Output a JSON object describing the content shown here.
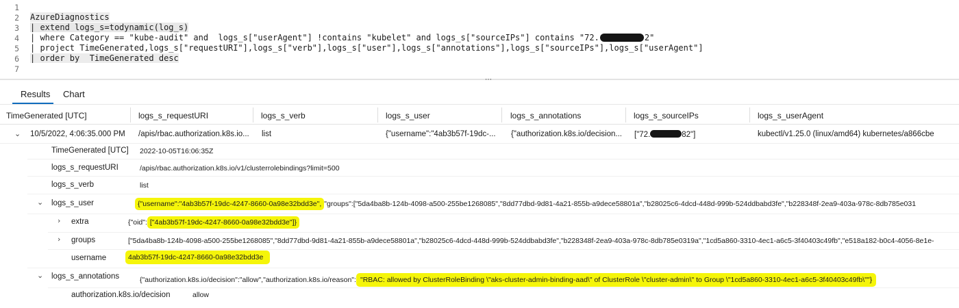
{
  "editor": {
    "line_numbers": [
      "1",
      "2",
      "3",
      "4",
      "5",
      "6",
      "7"
    ],
    "lines": {
      "l2": "AzureDiagnostics",
      "l3": "| extend logs_s=todynamic(log_s)",
      "l4a": "| where Category == \"kube-audit\" and  logs_s[\"userAgent\"] !contains \"kubelet\" and logs_s[\"sourceIPs\"] contains \"72.",
      "l4b": "2\"",
      "l5": "| project TimeGenerated,logs_s[\"requestURI\"],logs_s[\"verb\"],logs_s[\"user\"],logs_s[\"annotations\"],logs_s[\"sourceIPs\"],logs_s[\"userAgent\"]",
      "l6": "| order by  TimeGenerated desc"
    },
    "splitter_grip": "⋯"
  },
  "tabs": {
    "results": "Results",
    "chart": "Chart"
  },
  "columns": {
    "c1": "TimeGenerated [UTC]",
    "c2": "logs_s_requestURI",
    "c3": "logs_s_verb",
    "c4": "logs_s_user",
    "c5": "logs_s_annotations",
    "c6": "logs_s_sourceIPs",
    "c7": "logs_s_userAgent"
  },
  "row": {
    "time": "10/5/2022, 4:06:35.000 PM",
    "request_uri": "/apis/rbac.authorization.k8s.io...",
    "verb": "list",
    "user": "{\"username\":\"4ab3b57f-19dc-...",
    "annotations": "{\"authorization.k8s.io/decision...",
    "source_ips_a": "[\"72.",
    "source_ips_b": "82\"]",
    "user_agent": "kubectl/v1.25.0 (linux/amd64) kubernetes/a866cbe"
  },
  "details": {
    "time_label": "TimeGenerated [UTC]",
    "time_value": "2022-10-05T16:06:35Z",
    "uri_label": "logs_s_requestURI",
    "uri_value": "/apis/rbac.authorization.k8s.io/v1/clusterrolebindings?limit=500",
    "verb_label": "logs_s_verb",
    "verb_value": "list",
    "user_label": "logs_s_user",
    "user_value_hl": "{\"username\":\"4ab3b57f-19dc-4247-8660-0a98e32bdd3e\",",
    "user_value_rest": "\"groups\":[\"5da4ba8b-124b-4098-a500-255be1268085\",\"8dd77dbd-9d81-4a21-855b-a9dece58801a\",\"b28025c6-4dcd-448d-999b-524ddbabd3fe\",\"b228348f-2ea9-403a-978c-8db785e031",
    "extra_label": "extra",
    "extra_value_a": "{\"oid\":",
    "extra_value_hl": "[\"4ab3b57f-19dc-4247-8660-0a98e32bdd3e\"]}",
    "groups_label": "groups",
    "groups_value": "[\"5da4ba8b-124b-4098-a500-255be1268085\",\"8dd77dbd-9d81-4a21-855b-a9dece58801a\",\"b28025c6-4dcd-448d-999b-524ddbabd3fe\",\"b228348f-2ea9-403a-978c-8db785e0319a\",\"1cd5a860-3310-4ec1-a6c5-3f40403c49fb\",\"e518a182-b0c4-4056-8e1e-",
    "username_label": "username",
    "username_value": "4ab3b57f-19dc-4247-8660-0a98e32bdd3e",
    "annotations_label": "logs_s_annotations",
    "annotations_value_a": "{\"authorization.k8s.io/decision\":\"allow\",\"authorization.k8s.io/reason\":",
    "annotations_value_hl": "\"RBAC: allowed by ClusterRoleBinding \\\"aks-cluster-admin-binding-aad\\\" of ClusterRole \\\"cluster-admin\\\" to Group \\\"1cd5a860-3310-4ec1-a6c5-3f40403c49fb\\\"\"}",
    "decision_label": "authorization.k8s.io/decision",
    "decision_value": "allow"
  },
  "colors": {
    "highlight": "#f5f50a",
    "tab_accent": "#0f6cbd",
    "redaction": "#151515"
  },
  "icons": {
    "expanded": "chevron-down-icon",
    "collapsed": "chevron-right-icon"
  }
}
